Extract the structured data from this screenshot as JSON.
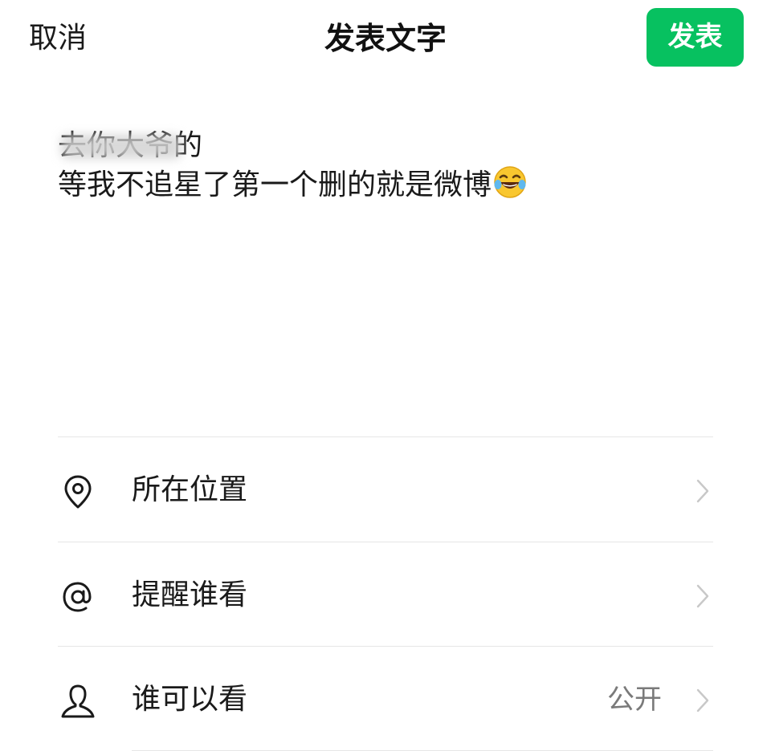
{
  "header": {
    "cancel_label": "取消",
    "title": "发表文字",
    "publish_label": "发表"
  },
  "compose": {
    "line1": "去你大爷的",
    "line2": "等我不追星了第一个删的就是微博",
    "emoji": "laughing-tears-emoji"
  },
  "options": [
    {
      "label": "所在位置",
      "icon": "location-pin-icon",
      "value": ""
    },
    {
      "label": "提醒谁看",
      "icon": "at-sign-icon",
      "value": ""
    },
    {
      "label": "谁可以看",
      "icon": "person-icon",
      "value": "公开"
    }
  ],
  "colors": {
    "accent": "#07c160",
    "text": "#1a1a1a",
    "secondary": "#7a7a7a",
    "divider": "#e6e6e6"
  }
}
